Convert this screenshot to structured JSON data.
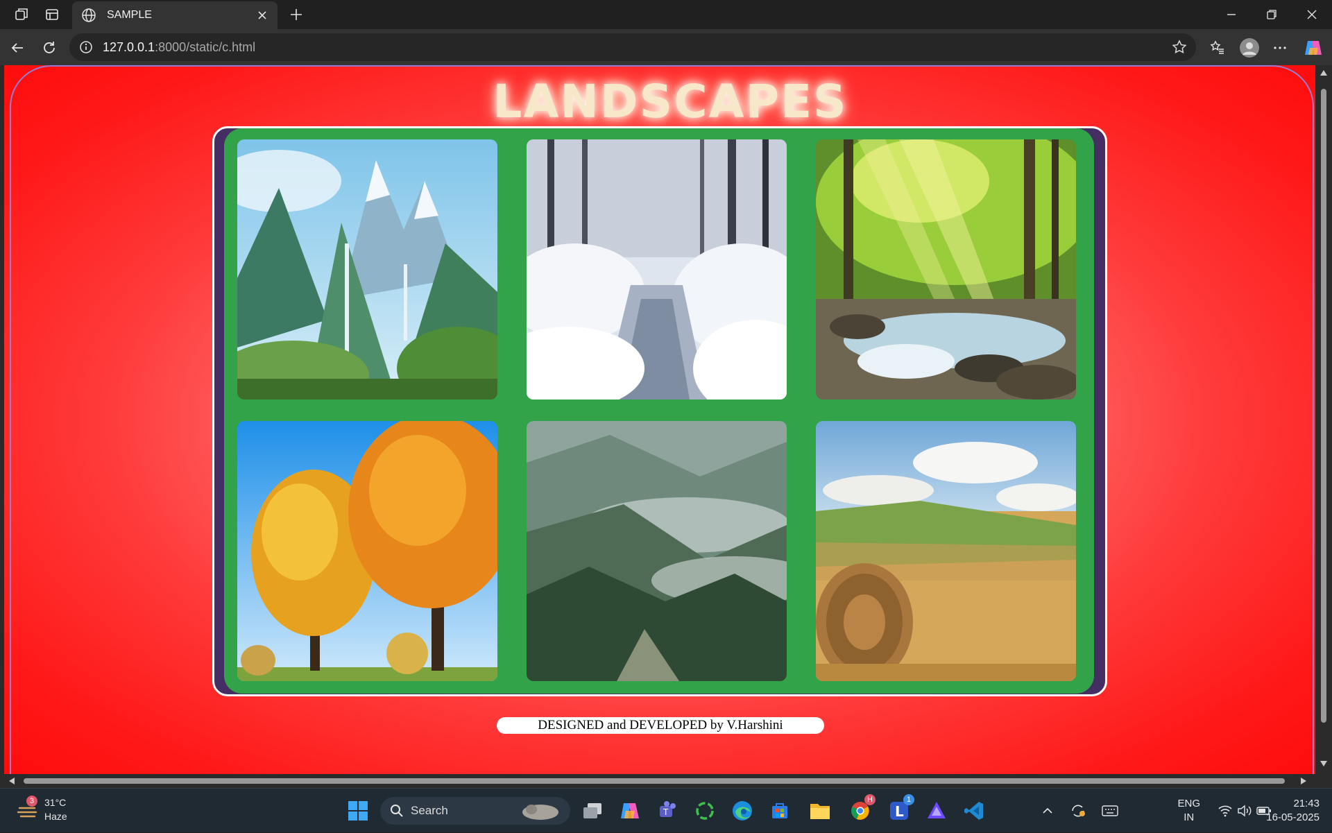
{
  "browser": {
    "tab_title": "SAMPLE",
    "url_host": "127.0.0.1",
    "url_path": ":8000/static/c.html"
  },
  "page": {
    "heading": "LANDSCAPES",
    "footer": "DESIGNED and DEVELOPED by V.Harshini",
    "photos": [
      {
        "name": "mountain-waterfall-image"
      },
      {
        "name": "snowy-forest-stream-image"
      },
      {
        "name": "sunlit-forest-river-image"
      },
      {
        "name": "autumn-trees-image"
      },
      {
        "name": "misty-rainy-forest-image"
      },
      {
        "name": "hay-bale-field-image"
      }
    ]
  },
  "taskbar": {
    "weather_temp": "31°C",
    "weather_desc": "Haze",
    "weather_badge": "3",
    "search_label": "Search",
    "chrome_badge": "H",
    "app_l_badge": "1",
    "lang_top": "ENG",
    "lang_bottom": "IN",
    "time": "21:43",
    "date": "16-05-2025"
  }
}
